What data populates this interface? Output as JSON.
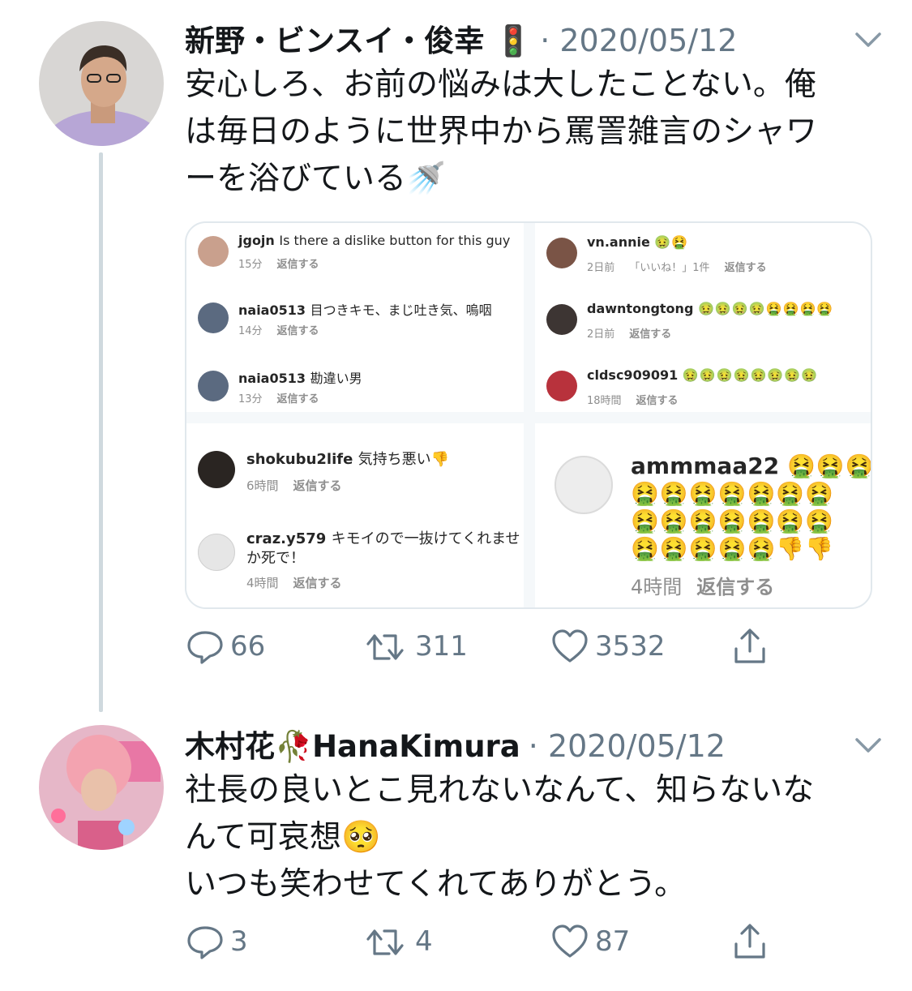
{
  "tweet1": {
    "name": "新野・ビンスイ・俊幸 🚦",
    "date": "· 2020/05/12",
    "text_lines": [
      "安心しろ、お前の悩みは大したことない。俺",
      "は毎日のように世界中から罵詈雑言のシャワ",
      "ーを浴びている🚿"
    ],
    "replies": "66",
    "retweets": "311",
    "likes": "3532",
    "embed": {
      "pane1": [
        {
          "user": "jgojn",
          "text": "Is there a dislike button for this guy",
          "time": "15分",
          "reply": "返信する"
        },
        {
          "user": "naia0513",
          "text": "目つきキモ、まじ吐き気、嗚咽",
          "time": "14分",
          "reply": "返信する"
        },
        {
          "user": "naia0513",
          "text": "勘違い男",
          "time": "13分",
          "reply": "返信する"
        }
      ],
      "pane2": [
        {
          "user": "vn.annie",
          "text": "🤢🤮",
          "time": "2日前",
          "likes": "「いいね！」1件",
          "reply": "返信する"
        },
        {
          "user": "dawntongtong",
          "text": "🤢🤢🤢🤢🤮🤮🤮🤮",
          "time": "2日前",
          "reply": "返信する"
        },
        {
          "user": "cldsc909091",
          "text": "🤢🤢🤢🤢🤢🤢🤢🤢",
          "time": "18時間",
          "reply": "返信する"
        }
      ],
      "pane3": [
        {
          "user": "shokubu2life",
          "text": "気持ち悪い👎",
          "time": "6時間",
          "reply": "返信する"
        },
        {
          "user": "craz.y579",
          "text": "キモイので一抜けてくれませ",
          "text2": "か死で！",
          "time": "4時間",
          "reply": "返信する"
        }
      ],
      "pane4": {
        "user": "ammmaa22",
        "emoji_lines": [
          "🤮🤮🤮",
          "🤮🤮🤮🤮🤮🤮🤮",
          "🤮🤮🤮🤮🤮🤮🤮",
          "🤮🤮🤮🤮🤮👎👎"
        ],
        "time": "4時間",
        "reply": "返信する"
      }
    }
  },
  "tweet2": {
    "name": "木村花🥀HanaKimura",
    "date": "· 2020/05/12",
    "text_lines": [
      "社長の良いとこ見れないなんて、知らないな",
      "んて可哀想🥺",
      "いつも笑わせてくれてありがとう。"
    ],
    "replies": "3",
    "retweets": "4",
    "likes": "87"
  },
  "colors": {
    "text": "#14171a",
    "muted": "#657786",
    "border": "#e1e8ed",
    "thread": "#cfd9de"
  },
  "icons": [
    "reply-icon",
    "retweet-icon",
    "like-icon",
    "share-icon",
    "chevron-down-icon"
  ]
}
